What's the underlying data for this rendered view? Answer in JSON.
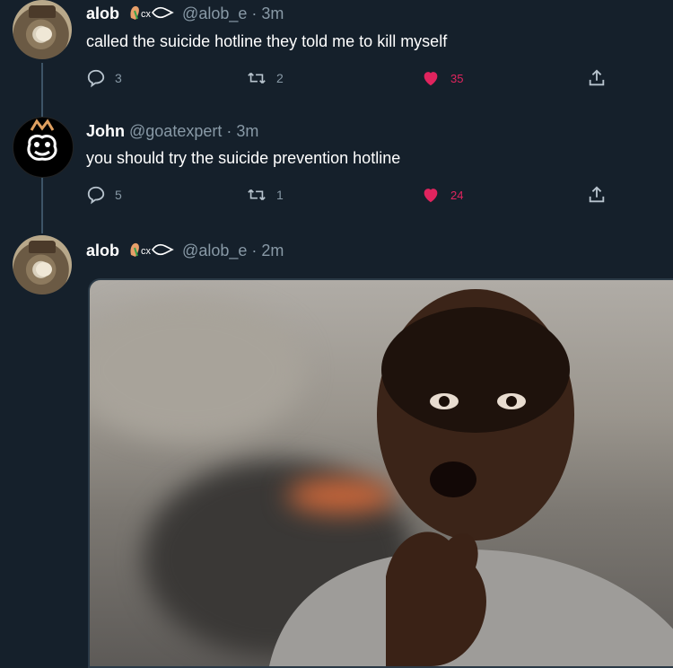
{
  "colors": {
    "background": "#15202b",
    "muted": "#8899a6",
    "like": "#e0245e",
    "thread_line": "#3d5466"
  },
  "tweets": [
    {
      "name": "alob",
      "handle": "@alob_e",
      "time": "· 3m",
      "text": "called the suicide hotline they told me to kill myself",
      "actions": {
        "reply": "3",
        "retweet": "2",
        "like": "35"
      },
      "avatar_icon": "hamster-avatar"
    },
    {
      "name": "John",
      "handle": "@goatexpert",
      "time": "· 3m",
      "text": "you should try the suicide prevention hotline",
      "actions": {
        "reply": "5",
        "retweet": "1",
        "like": "24"
      },
      "avatar_icon": "cat-doodle-avatar"
    },
    {
      "name": "alob",
      "handle": "@alob_e",
      "time": "· 2m",
      "avatar_icon": "hamster-avatar",
      "media_icon": "shocked-man-gif"
    }
  ],
  "icons": {
    "reply": "reply-icon",
    "retweet": "retweet-icon",
    "like": "heart-icon",
    "share": "share-icon"
  }
}
